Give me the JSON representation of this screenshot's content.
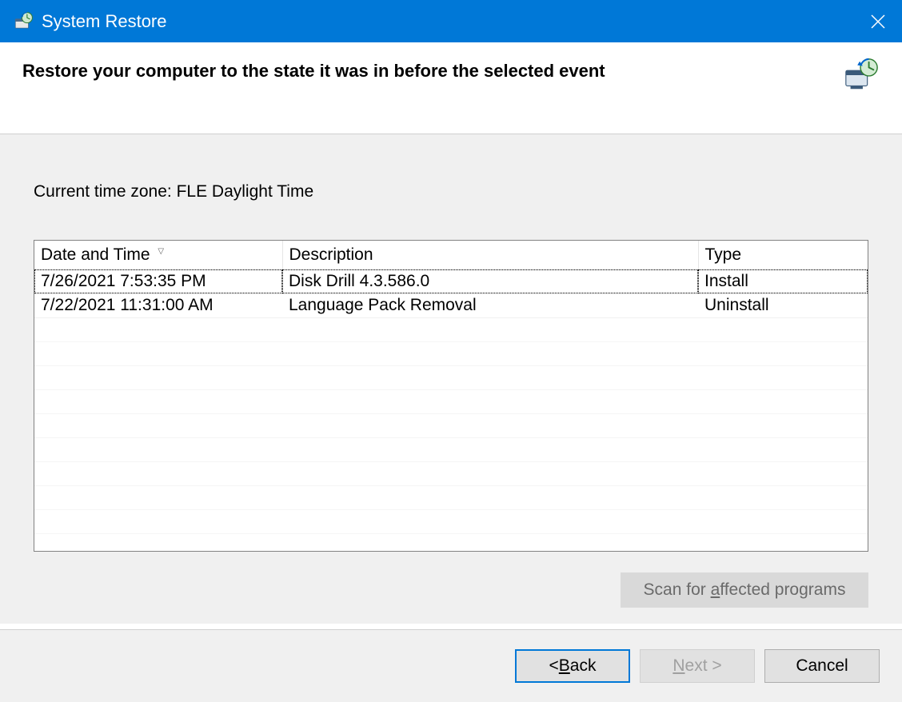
{
  "window": {
    "title": "System Restore"
  },
  "header": {
    "instruction": "Restore your computer to the state it was in before the selected event"
  },
  "body": {
    "timezone_label": "Current time zone: FLE Daylight Time",
    "columns": {
      "date": "Date and Time",
      "desc": "Description",
      "type": "Type"
    },
    "rows": [
      {
        "date": "7/26/2021 7:53:35 PM",
        "desc": "Disk Drill 4.3.586.0",
        "type": "Install"
      },
      {
        "date": "7/22/2021 11:31:00 AM",
        "desc": "Language Pack Removal",
        "type": "Uninstall"
      }
    ],
    "scan_button_prefix": "Scan for ",
    "scan_button_ul": "a",
    "scan_button_suffix": "ffected programs"
  },
  "footer": {
    "back_prefix": "< ",
    "back_ul": "B",
    "back_suffix": "ack",
    "next_ul": "N",
    "next_suffix": "ext >",
    "cancel": "Cancel"
  }
}
